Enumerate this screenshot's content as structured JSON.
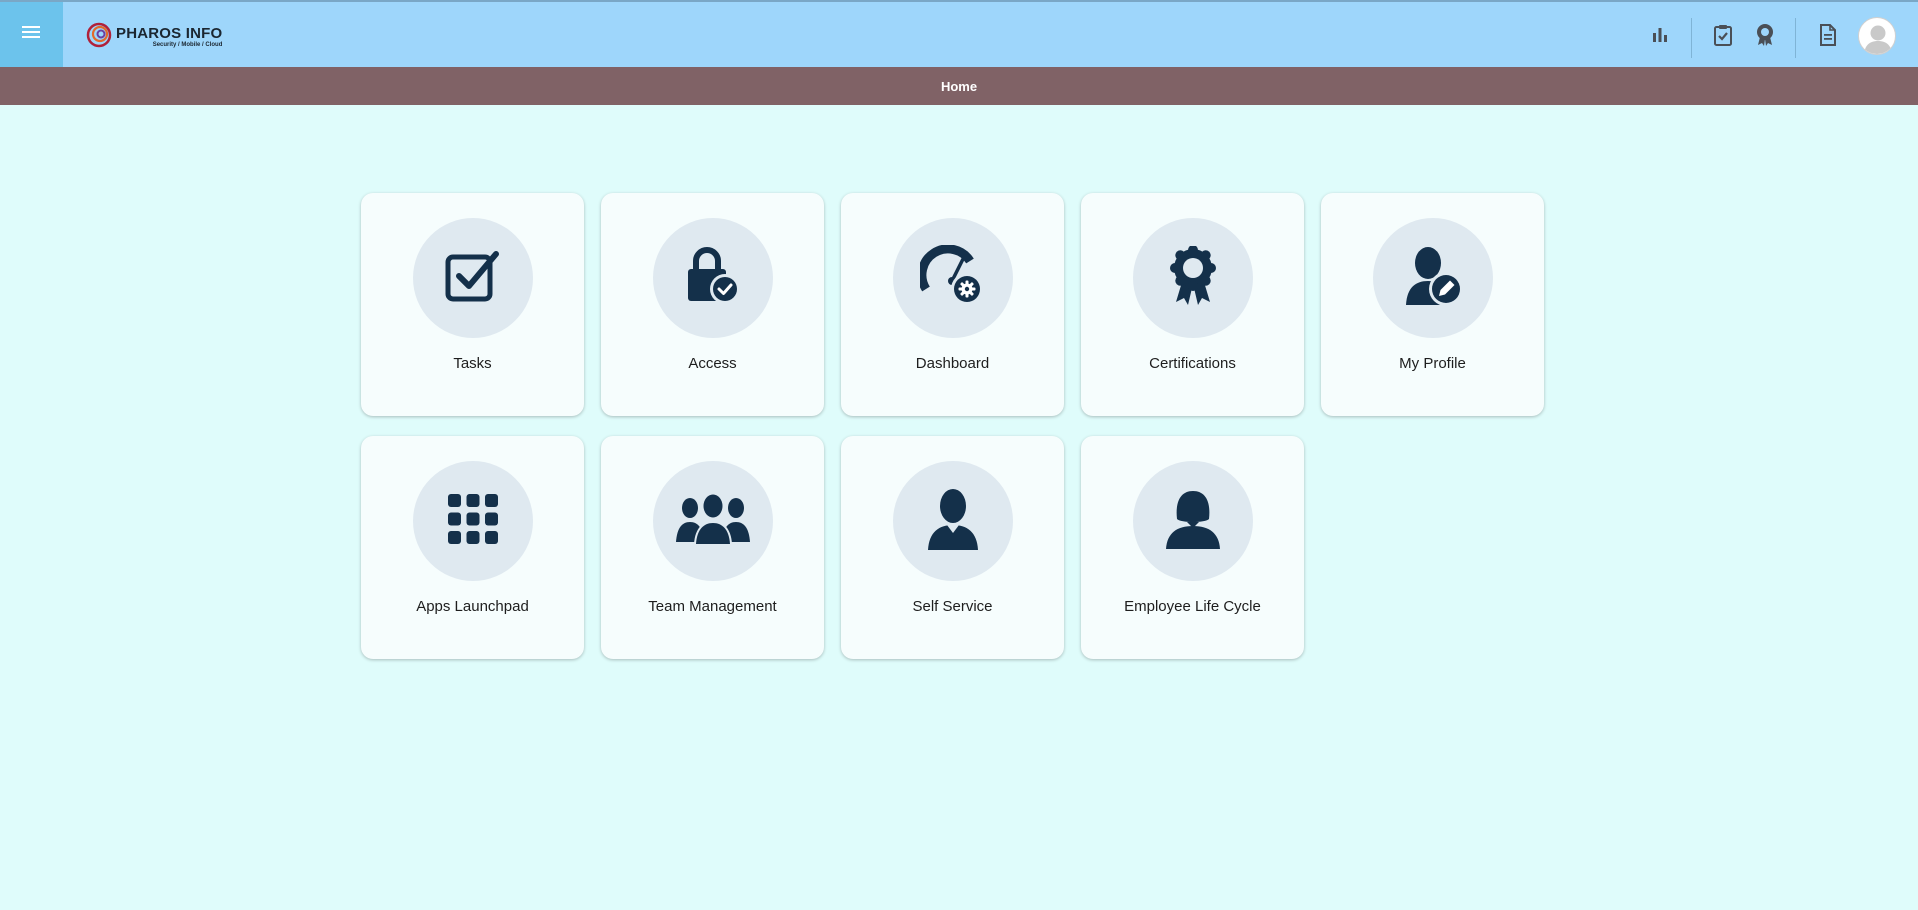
{
  "header": {
    "menu_icon": "hamburger-icon",
    "logo": {
      "name": "PHAROS INFO",
      "tagline": "Security / Mobile / Cloud"
    },
    "actions": [
      {
        "name": "reports-icon"
      },
      {
        "name": "clipboard-check-icon"
      },
      {
        "name": "award-icon"
      },
      {
        "name": "document-icon"
      },
      {
        "name": "user-avatar-icon"
      }
    ]
  },
  "breadcrumb": {
    "title": "Home"
  },
  "tiles": [
    {
      "label": "Tasks",
      "icon": "checkbox-icon"
    },
    {
      "label": "Access",
      "icon": "lock-check-icon"
    },
    {
      "label": "Dashboard",
      "icon": "gauge-gear-icon"
    },
    {
      "label": "Certifications",
      "icon": "certificate-icon"
    },
    {
      "label": "My Profile",
      "icon": "user-edit-icon"
    },
    {
      "label": "Apps Launchpad",
      "icon": "apps-grid-icon"
    },
    {
      "label": "Team Management",
      "icon": "team-icon"
    },
    {
      "label": "Self Service",
      "icon": "user-icon"
    },
    {
      "label": "Employee Life Cycle",
      "icon": "employee-icon"
    }
  ],
  "colors": {
    "topbar": "#9ed6fb",
    "menu_button": "#6cc3ec",
    "breadcrumb_bar": "#806266",
    "page_background": "#dffcfb",
    "icon_dark": "#14304a"
  }
}
